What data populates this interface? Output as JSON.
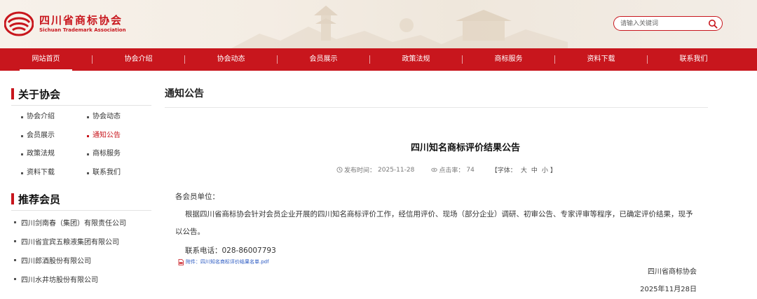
{
  "header": {
    "logo_cn": "四川省商标协会",
    "logo_en": "Sichuan Trademark Association",
    "search_placeholder": "请输入关键词"
  },
  "nav": {
    "items": [
      {
        "label": "网站首页",
        "active": true
      },
      {
        "label": "协会介绍"
      },
      {
        "label": "协会动态"
      },
      {
        "label": "会员展示"
      },
      {
        "label": "政策法规"
      },
      {
        "label": "商标服务"
      },
      {
        "label": "资料下载"
      },
      {
        "label": "联系我们"
      }
    ]
  },
  "sidebar": {
    "about_title": "关于协会",
    "links": [
      {
        "label": "协会介绍"
      },
      {
        "label": "协会动态"
      },
      {
        "label": "会员展示"
      },
      {
        "label": "通知公告",
        "active": true
      },
      {
        "label": "政策法规"
      },
      {
        "label": "商标服务"
      },
      {
        "label": "资料下载"
      },
      {
        "label": "联系我们"
      }
    ],
    "recommend_title": "推荐会员",
    "members": [
      "四川剑南春（集团）有限责任公司",
      "四川省宜宾五粮液集团有限公司",
      "四川郎酒股份有限公司",
      "四川水井坊股份有限公司"
    ]
  },
  "main": {
    "section_title": "通知公告",
    "article": {
      "title": "四川知名商标评价结果公告",
      "publish_label": "发布时间：",
      "publish_date": "2025-11-28",
      "views_label": "点击率：",
      "views": "74",
      "font_label_open": "【字体：",
      "font_large": "大",
      "font_medium": "中",
      "font_small": "小",
      "font_label_close": "】",
      "salutation": "各会员单位：",
      "body": "根据四川省商标协会针对会员企业开展的四川知名商标评价工作，经信用评价、现场（部分企业）调研、初审公告、专家评审等程序，已确定评价结果，现予以公告。",
      "phone": "联系电话：028-86007793",
      "attachment": "附件：四川知名商标评价结果名单.pdf",
      "signature": "四川省商标协会",
      "sign_date": "2025年11月28日"
    }
  },
  "colors": {
    "brand_red": "#c8161d",
    "link_blue": "#2a59c2"
  },
  "icons": [
    "logo-mark-icon",
    "search-icon",
    "clock-icon",
    "eye-icon",
    "pdf-icon"
  ]
}
